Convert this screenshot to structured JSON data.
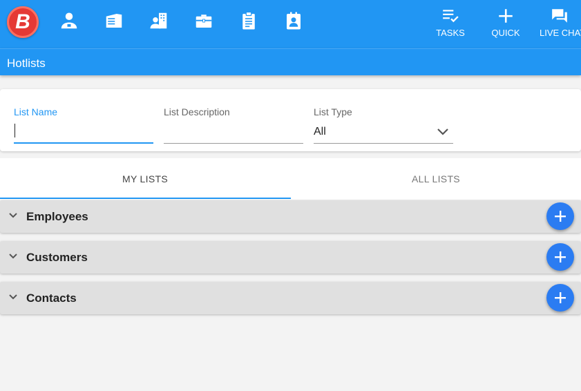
{
  "app": {
    "logo_letter": "B",
    "brand_color": "#2196f3",
    "logo_color": "#e53935"
  },
  "nav": {
    "icons": [
      "person-icon",
      "building-icon",
      "people-building-icon",
      "briefcase-icon",
      "clipboard-icon",
      "contact-card-icon"
    ],
    "right_buttons": [
      {
        "icon": "tasks-icon",
        "label": "TASKS"
      },
      {
        "icon": "plus-icon",
        "label": "QUICK"
      },
      {
        "icon": "chat-icon",
        "label": "LIVE CHAT"
      }
    ]
  },
  "page": {
    "title": "Hotlists"
  },
  "filters": {
    "list_name": {
      "label": "List Name",
      "value": ""
    },
    "list_description": {
      "label": "List Description",
      "value": ""
    },
    "list_type": {
      "label": "List Type",
      "value": "All"
    }
  },
  "tabs": [
    {
      "label": "MY LISTS",
      "active": true
    },
    {
      "label": "ALL LISTS",
      "active": false
    }
  ],
  "panels": [
    {
      "label": "Employees"
    },
    {
      "label": "Customers"
    },
    {
      "label": "Contacts"
    }
  ],
  "colors": {
    "fab": "#2b7cf2",
    "panel_bg": "#e0e0e0",
    "page_bg": "#f3f3f3"
  }
}
